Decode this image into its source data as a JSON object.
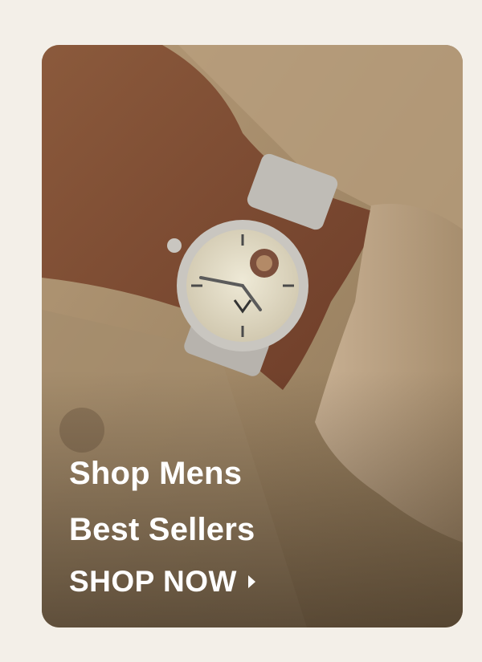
{
  "promo": {
    "headline_line1": "Shop Mens",
    "headline_line2": "Best Sellers",
    "cta_label": "SHOP NOW",
    "cta_icon": "chevron-right-icon",
    "image_subject": "watch-on-wrist-photo"
  },
  "colors": {
    "page_background": "#f3efe8",
    "text": "#ffffff"
  }
}
